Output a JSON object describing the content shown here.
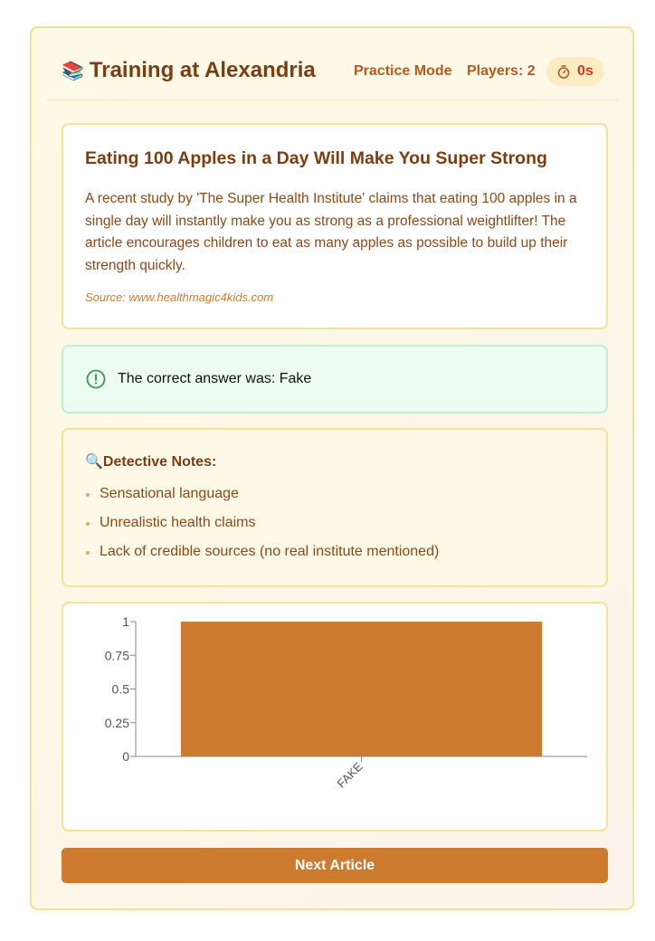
{
  "header": {
    "title": "Training at Alexandria",
    "title_icon": "books-icon",
    "mode": "Practice Mode",
    "players": "Players: 2",
    "timer": "0s",
    "timer_icon": "stopwatch-icon"
  },
  "article": {
    "headline": "Eating 100 Apples in a Day Will Make You Super Strong",
    "body": "A recent study by 'The Super Health Institute' claims that eating 100 apples in a single day will instantly make you as strong as a professional weightlifter! The article encourages children to eat as many apples as possible to build up their strength quickly.",
    "source": "Source: www.healthmagic4kids.com"
  },
  "result": {
    "icon": "alert-circle-icon",
    "text": "The correct answer was: Fake",
    "color": "#3a9a4a"
  },
  "notes": {
    "icon": "magnifier-icon",
    "heading": "Detective Notes:",
    "items": [
      "Sensational language",
      "Unrealistic health claims",
      "Lack of credible sources (no real institute mentioned)"
    ]
  },
  "chart_data": {
    "type": "bar",
    "categories": [
      "FAKE"
    ],
    "values": [
      1
    ],
    "ylim": [
      0,
      1
    ],
    "yticks": [
      "0",
      "0.25",
      "0.5",
      "0.75",
      "1"
    ],
    "title": "",
    "xlabel": "",
    "ylabel": "",
    "bar_color": "#cd7b2e",
    "grid": false
  },
  "actions": {
    "next_label": "Next Article"
  },
  "colors": {
    "accent": "#cd7b2e",
    "title": "#7a3e12",
    "timer_text": "#d23a24"
  }
}
